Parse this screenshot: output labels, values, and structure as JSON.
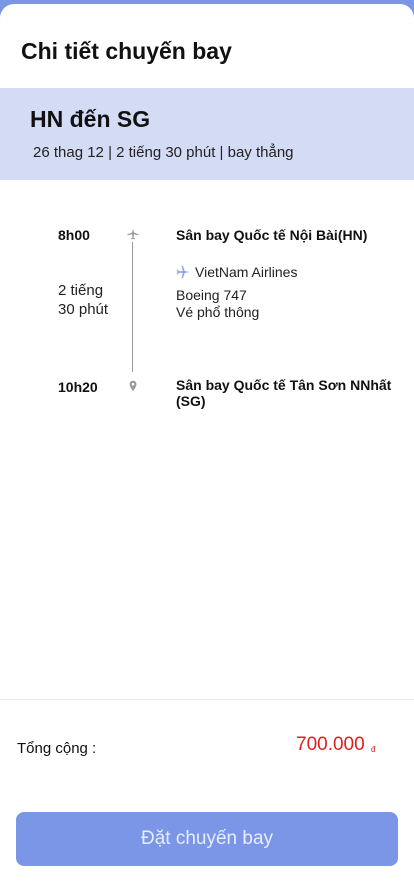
{
  "page": {
    "title": "Chi tiết chuyến bay"
  },
  "route": {
    "title": "HN đến SG",
    "meta": "26 thag 12 |  2 tiếng 30 phút | bay thẳng"
  },
  "timeline": {
    "departure_time": "8h00",
    "departure_airport": "Sân bay Quốc tế Nội Bài(HN)",
    "duration_line1": "2 tiếng",
    "duration_line2": "30 phút",
    "airline": "VietNam Airlines",
    "aircraft": "Boeing 747",
    "fare_class": "Vé phổ thông",
    "arrival_time": "10h20",
    "arrival_airport": "Sân bay Quốc tế Tân Sơn NNhất (SG)",
    "departure_icon": "plane-icon",
    "arrival_icon": "location-pin-icon",
    "airline_icon": "plane-icon"
  },
  "summary": {
    "total_label": "Tổng cộng :",
    "total_value": "700.000",
    "currency": "đ"
  },
  "actions": {
    "book_label": "Đặt chuyến bay"
  },
  "colors": {
    "accent": "#7b96e6",
    "band": "#d4dcf5",
    "price": "#e02020"
  }
}
